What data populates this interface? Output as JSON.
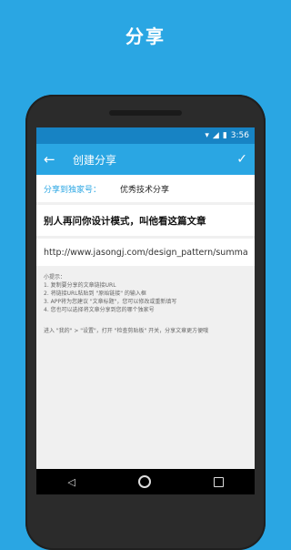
{
  "promo": {
    "title": "分享"
  },
  "status_bar": {
    "time": "3:56"
  },
  "toolbar": {
    "title": "创建分享"
  },
  "form": {
    "share_to_label": "分享到独家号：",
    "share_to_value": "优秀技术分享",
    "article_title": "别人再问你设计模式，叫他看这篇文章",
    "article_url": "http://www.jasongj.com/design_pattern/summa"
  },
  "tips": {
    "heading": "小提示：",
    "items": [
      "1. 复制要分享的文章链接URL",
      "2. 将链接URL粘贴到 \"原始链接\" 的输入框",
      "3. APP将为您建议 \"文章标题\"，您可以修改或重新填写",
      "4. 您也可以选择将文章分享到您的哪个独家号"
    ],
    "extra": "进入 \"我的\" > \"设置\"，打开 \"检查剪贴板\" 开关，分享文章更方便哦"
  }
}
